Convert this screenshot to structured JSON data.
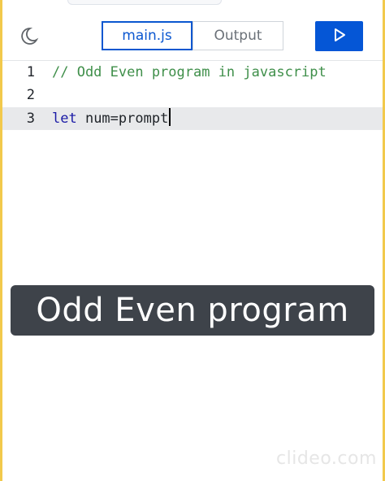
{
  "toolbar": {
    "theme_icon": "moon-icon",
    "tabs": [
      {
        "label": "main.js",
        "active": true
      },
      {
        "label": "Output",
        "active": false
      }
    ],
    "run_icon": "play-icon",
    "run_color": "#0556d6",
    "accent": "#0b57d0"
  },
  "editor": {
    "lines": [
      {
        "number": "1",
        "text": "// Odd Even program in javascript",
        "kind": "comment"
      },
      {
        "number": "2",
        "text": "",
        "kind": "blank"
      },
      {
        "number": "3",
        "keyword": "let",
        "rest": " num=prompt",
        "kind": "code",
        "active": true
      }
    ]
  },
  "overlay": {
    "caption": "Odd Even program",
    "watermark": "clideo.com"
  }
}
